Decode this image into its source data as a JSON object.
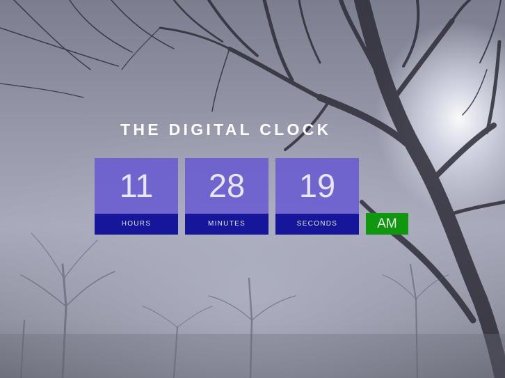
{
  "page": {
    "title": "THE DIGITAL CLOCK"
  },
  "clock": {
    "hours": {
      "value": "11",
      "label": "HOURS"
    },
    "minutes": {
      "value": "28",
      "label": "MINUTES"
    },
    "seconds": {
      "value": "19",
      "label": "SECONDS"
    },
    "period": "AM"
  },
  "background": {
    "description_icon": "foggy-trees-background"
  },
  "colors": {
    "value_box": "#6455d2",
    "label_box": "#15169a",
    "period_box": "#11960f",
    "title_text": "#ffffff"
  }
}
